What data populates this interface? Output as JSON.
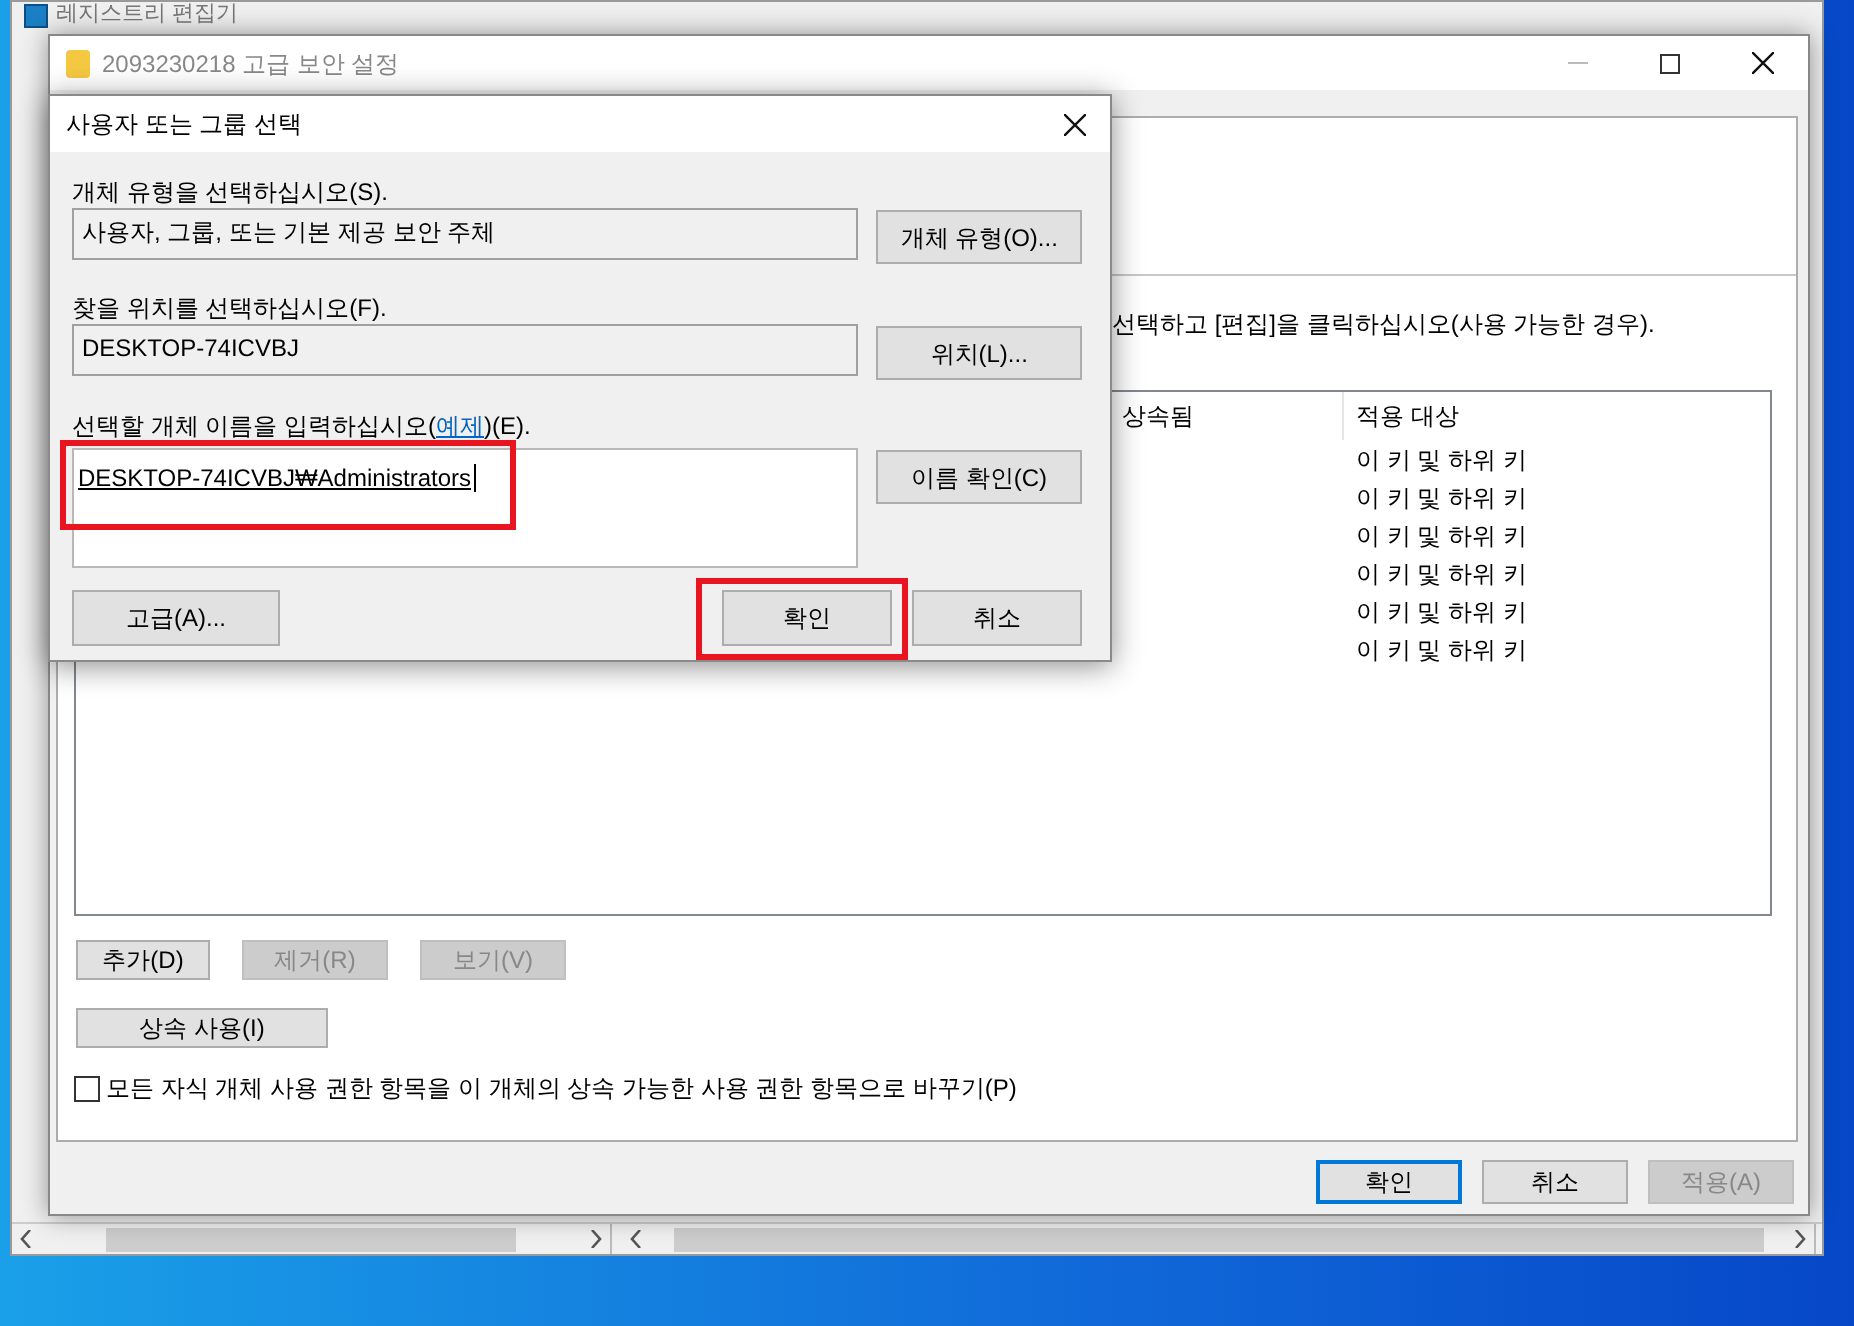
{
  "background_window": {
    "title": "레지스트리 편집기"
  },
  "security_window": {
    "title": "2093230218 고급 보안 설정",
    "instruction": "선택하고 [편집]을 클릭하십시오(사용 가능한 경우).",
    "permissions_table": {
      "columns": [
        "상속됨",
        "적용 대상"
      ],
      "rows": [
        {
          "applies_to": "이 키 및 하위 키"
        },
        {
          "applies_to": "이 키 및 하위 키"
        },
        {
          "applies_to": "이 키 및 하위 키"
        },
        {
          "applies_to": "이 키 및 하위 키"
        },
        {
          "applies_to": "이 키 및 하위 키"
        },
        {
          "applies_to": "이 키 및 하위 키"
        }
      ]
    },
    "entry_buttons": [
      {
        "label": "추가(D)",
        "disabled": false
      },
      {
        "label": "제거(R)",
        "disabled": true
      },
      {
        "label": "보기(V)",
        "disabled": true
      }
    ],
    "inherit_button": "상속 사용(I)",
    "replace_checkbox": {
      "label": "모든 자식 개체 사용 권한 항목을 이 개체의 상속 가능한 사용 권한 항목으로 바꾸기(P)",
      "checked": false
    },
    "footer_buttons": [
      {
        "label": "확인",
        "default": true,
        "disabled": false
      },
      {
        "label": "취소",
        "default": false,
        "disabled": false
      },
      {
        "label": "적용(A)",
        "default": false,
        "disabled": true
      }
    ]
  },
  "dialog": {
    "title": "사용자 또는 그룹 선택",
    "object_type": {
      "label": "개체 유형을 선택하십시오(S).",
      "value": "사용자, 그룹, 또는 기본 제공 보안 주체",
      "button": "개체 유형(O)..."
    },
    "location": {
      "label": "찾을 위치를 선택하십시오(F).",
      "value": "DESKTOP-74ICVBJ",
      "button": "위치(L)..."
    },
    "names": {
      "label_before": "선택할 개체 이름을 입력하십시오(",
      "link": "예제",
      "label_after": ")(E).",
      "value": "DESKTOP-74ICVBJ₩Administrators",
      "button": "이름 확인(C)"
    },
    "advanced_button": "고급(A)...",
    "buttons": [
      {
        "label": "확인",
        "highlighted": true
      },
      {
        "label": "취소",
        "highlighted": false
      }
    ]
  }
}
